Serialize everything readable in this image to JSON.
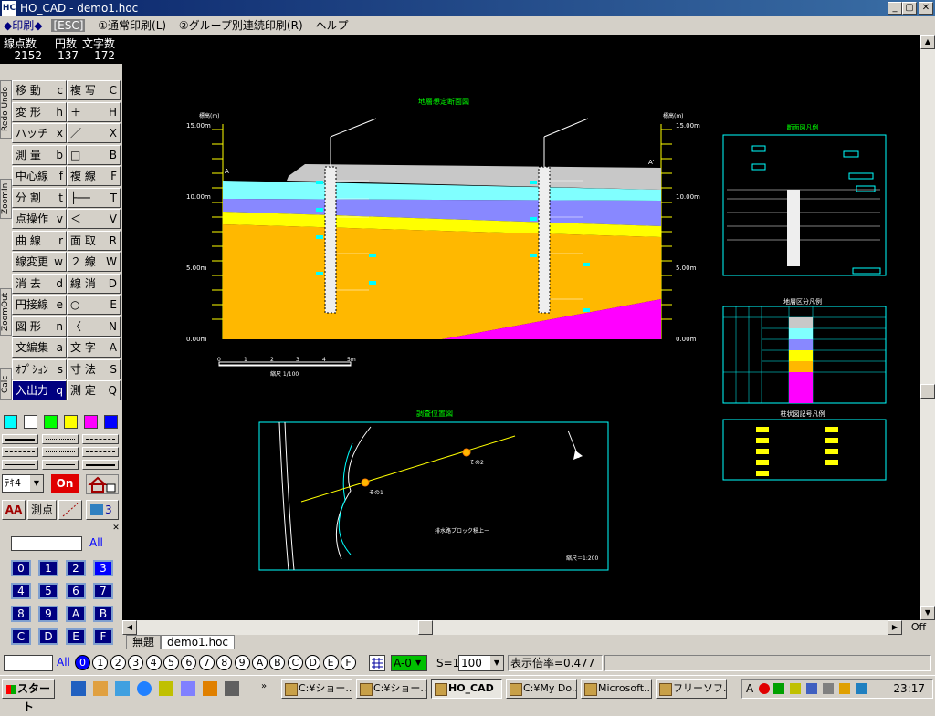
{
  "window": {
    "title": "HO_CAD - demo1.hoc",
    "app_icon": "HC",
    "minimize": "_",
    "restore": "▢",
    "close": "✕"
  },
  "menu": {
    "print": "◆印刷◆",
    "esc": "[ESC]",
    "item1": "①通常印刷(L)",
    "item2": "②グループ別連続印刷(R)",
    "help": "ヘルプ"
  },
  "counts": {
    "h1": "線点数",
    "h2": "円数",
    "h3": "文字数",
    "v1": "2152",
    "v2": "137",
    "v3": "172"
  },
  "side_tabs": {
    "redo_undo": "Redo Undo",
    "zoom_in": "ZoomIn",
    "zoom_out": "ZoomOut",
    "calc": "Calc"
  },
  "commands": [
    {
      "l": "移 動",
      "k": "c"
    },
    {
      "l": "複 写",
      "k": "C"
    },
    {
      "l": "変 形",
      "k": "h"
    },
    {
      "l": "＋",
      "k": "H"
    },
    {
      "l": "ハッチ",
      "k": "x"
    },
    {
      "l": "／",
      "k": "X"
    },
    {
      "l": "測 量",
      "k": "b"
    },
    {
      "l": "□",
      "k": "B"
    },
    {
      "l": "中心線",
      "k": "f"
    },
    {
      "l": "複 線",
      "k": "F"
    },
    {
      "l": "分 割",
      "k": "t"
    },
    {
      "l": "├──",
      "k": "T"
    },
    {
      "l": "点操作",
      "k": "v"
    },
    {
      "l": "＜",
      "k": "V"
    },
    {
      "l": "曲 線",
      "k": "r"
    },
    {
      "l": "面 取",
      "k": "R"
    },
    {
      "l": "線変更",
      "k": "w"
    },
    {
      "l": "２ 線",
      "k": "W"
    },
    {
      "l": "消 去",
      "k": "d"
    },
    {
      "l": "線 消",
      "k": "D"
    },
    {
      "l": "円接線",
      "k": "e"
    },
    {
      "l": "○",
      "k": "E"
    },
    {
      "l": "図 形",
      "k": "n"
    },
    {
      "l": "〈",
      "k": "N"
    },
    {
      "l": "文編集",
      "k": "a"
    },
    {
      "l": "文 字",
      "k": "A"
    },
    {
      "l": "ｵﾌﾟｼｮﾝ",
      "k": "s"
    },
    {
      "l": "寸 法",
      "k": "S"
    },
    {
      "l": "入出力",
      "k": "q"
    },
    {
      "l": "測 定",
      "k": "Q"
    }
  ],
  "colors": [
    "#00ffff",
    "#ffffff",
    "#00ff00",
    "#ffff00",
    "#ff00ff",
    "#0000ff"
  ],
  "tools": {
    "font": "ﾃｷ4",
    "on": "On",
    "measure": "測点",
    "count": "3",
    "aa": "AA"
  },
  "layers": {
    "all_label": "All",
    "buttons": [
      "0",
      "1",
      "2",
      "3",
      "4",
      "5",
      "6",
      "7",
      "8",
      "9",
      "A",
      "B",
      "C",
      "D",
      "E",
      "F"
    ]
  },
  "status": {
    "all": "All",
    "layers": [
      "0",
      "1",
      "2",
      "3",
      "4",
      "5",
      "6",
      "7",
      "8",
      "9",
      "A",
      "B",
      "C",
      "D",
      "E",
      "F"
    ],
    "layer_select": "A-0",
    "scale_label": "S=1:",
    "scale_value": "100",
    "zoom": "表示倍率=0.477",
    "off": "Off"
  },
  "doc_tabs": [
    "無題",
    "demo1.hoc"
  ],
  "taskbar": {
    "start": "スタート",
    "tasks": [
      "C:¥ショー...",
      "C:¥ショー...",
      "HO_CAD",
      "C:¥My Do...",
      "Microsoft...",
      "フリーソフ..."
    ],
    "clock": "23:17"
  },
  "drawing": {
    "section_title": "地層想定断面図",
    "ylabel": "標高(m)",
    "ticks": [
      "15.00m",
      "10.00m",
      "5.00m",
      "0.00m"
    ],
    "point_a": "A",
    "point_a2": "A'",
    "scale_bar": "縮尺 1/100",
    "scale_nums": [
      "0",
      "1",
      "2",
      "3",
      "4",
      "5m"
    ],
    "map_title": "調査位置図",
    "map_scale": "縮尺＝1:200",
    "map_label": "排水路ブロック積上ー",
    "bh1": "その1",
    "bh2": "その2",
    "legend1_title": "断面図凡例",
    "legend2_title": "地層区分凡例",
    "legend3_title": "柱状図記号凡例"
  }
}
